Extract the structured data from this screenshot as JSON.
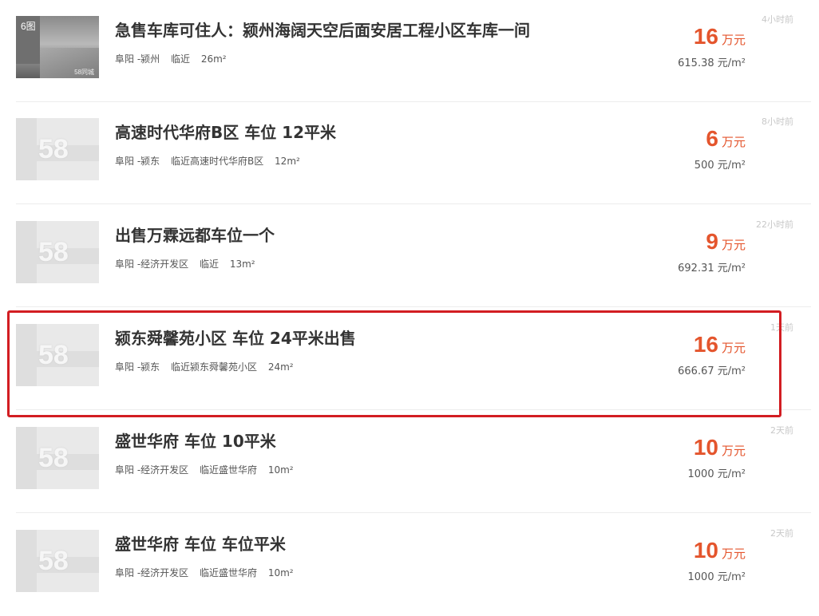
{
  "listings": [
    {
      "title": "急售车库可住人：颍州海阔天空后面安居工程小区车库一间",
      "meta": [
        "阜阳 -颍州",
        "临近",
        "26m²"
      ],
      "price": "16",
      "price_unit": "万元",
      "unit_price": "615.38 元/m²",
      "time": "4小时前",
      "thumb_badge": "6图",
      "thumb_watermark": "58同城",
      "thumb_type": "photo"
    },
    {
      "title": "高速时代华府B区 车位 12平米",
      "meta": [
        "阜阳 -颍东",
        "临近高速时代华府B区",
        "12m²"
      ],
      "price": "6",
      "price_unit": "万元",
      "unit_price": "500 元/m²",
      "time": "8小时前",
      "thumb_logo": "58",
      "thumb_type": "placeholder"
    },
    {
      "title": "出售万霖远都车位一个",
      "meta": [
        "阜阳 -经济开发区",
        "临近",
        "13m²"
      ],
      "price": "9",
      "price_unit": "万元",
      "unit_price": "692.31 元/m²",
      "time": "22小时前",
      "thumb_logo": "58",
      "thumb_type": "placeholder"
    },
    {
      "title": "颍东舜馨苑小区 车位 24平米出售",
      "meta": [
        "阜阳 -颍东",
        "临近颍东舜馨苑小区",
        "24m²"
      ],
      "price": "16",
      "price_unit": "万元",
      "unit_price": "666.67 元/m²",
      "time": "1天前",
      "thumb_logo": "58",
      "thumb_type": "placeholder"
    },
    {
      "title": "盛世华府 车位 10平米",
      "meta": [
        "阜阳 -经济开发区",
        "临近盛世华府",
        "10m²"
      ],
      "price": "10",
      "price_unit": "万元",
      "unit_price": "1000 元/m²",
      "time": "2天前",
      "thumb_logo": "58",
      "thumb_type": "placeholder"
    },
    {
      "title": "盛世华府 车位 车位平米",
      "meta": [
        "阜阳 -经济开发区",
        "临近盛世华府",
        "10m²"
      ],
      "price": "10",
      "price_unit": "万元",
      "unit_price": "1000 元/m²",
      "time": "2天前",
      "thumb_logo": "58",
      "thumb_type": "placeholder"
    }
  ],
  "colors": {
    "price": "#e4552d",
    "highlight_border": "#d21d22",
    "time_text": "#c8c8c8"
  }
}
